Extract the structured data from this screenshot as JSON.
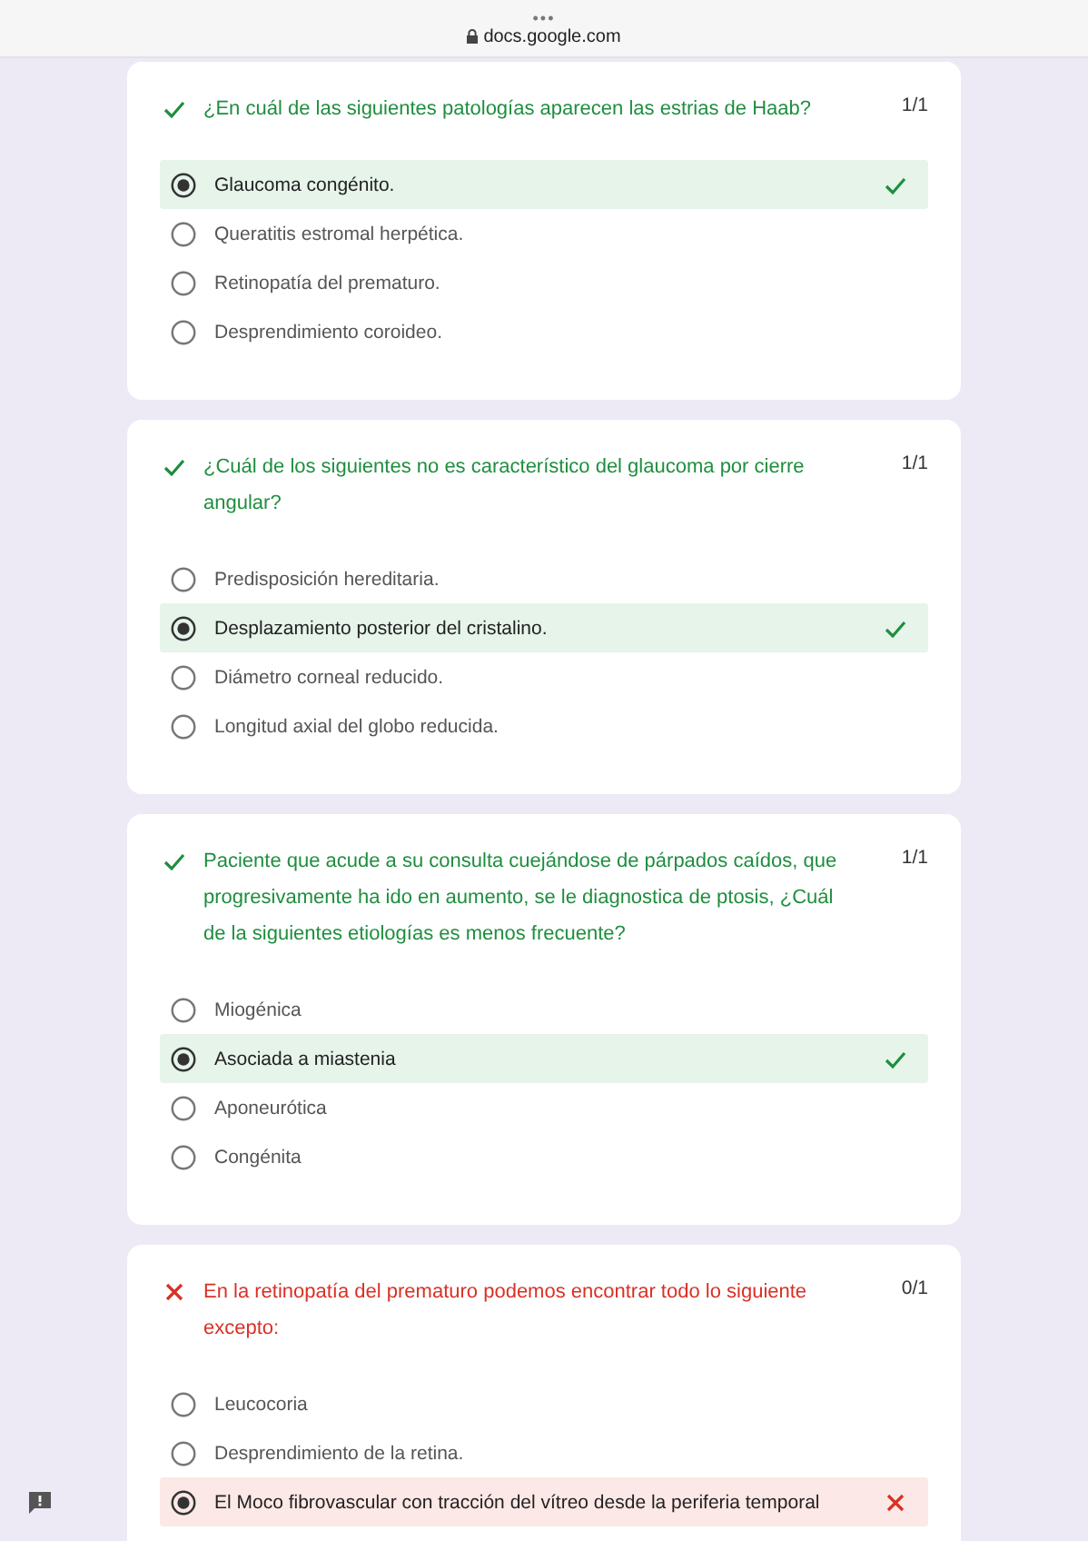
{
  "browser_bar": {
    "menu": "•••",
    "url": "docs.google.com"
  },
  "questions": [
    {
      "correct": true,
      "text": "¿En cuál de las siguientes patologías aparecen las estrias de Haab?",
      "score": "1/1",
      "options": [
        {
          "text": "Glaucoma congénito.",
          "selected": true
        },
        {
          "text": "Queratitis estromal herpética.",
          "selected": false
        },
        {
          "text": "Retinopatía del prematuro.",
          "selected": false
        },
        {
          "text": "Desprendimiento coroideo.",
          "selected": false
        }
      ]
    },
    {
      "correct": true,
      "text": "¿Cuál de los siguientes no es característico del glaucoma por cierre angular?",
      "score": "1/1",
      "options": [
        {
          "text": "Predisposición hereditaria.",
          "selected": false
        },
        {
          "text": "Desplazamiento posterior del cristalino.",
          "selected": true
        },
        {
          "text": "Diámetro corneal reducido.",
          "selected": false
        },
        {
          "text": "Longitud axial del globo reducida.",
          "selected": false
        }
      ]
    },
    {
      "correct": true,
      "text": "Paciente que acude a su consulta cuejándose de párpados caídos, que progresivamente ha ido en aumento, se le diagnostica de ptosis, ¿Cuál de la siguientes etiologías es menos frecuente?",
      "score": "1/1",
      "options": [
        {
          "text": "Miogénica",
          "selected": false
        },
        {
          "text": "Asociada a miastenia",
          "selected": true
        },
        {
          "text": "Aponeurótica",
          "selected": false
        },
        {
          "text": "Congénita",
          "selected": false
        }
      ]
    },
    {
      "correct": false,
      "text": "En la retinopatía del prematuro podemos encontrar todo lo siguiente excepto:",
      "score": "0/1",
      "options": [
        {
          "text": "Leucocoria",
          "selected": false
        },
        {
          "text": "Desprendimiento de la retina.",
          "selected": false
        },
        {
          "text": "El Moco fibrovascular con tracción del vítreo desde la periferia temporal",
          "selected": true
        }
      ]
    }
  ]
}
